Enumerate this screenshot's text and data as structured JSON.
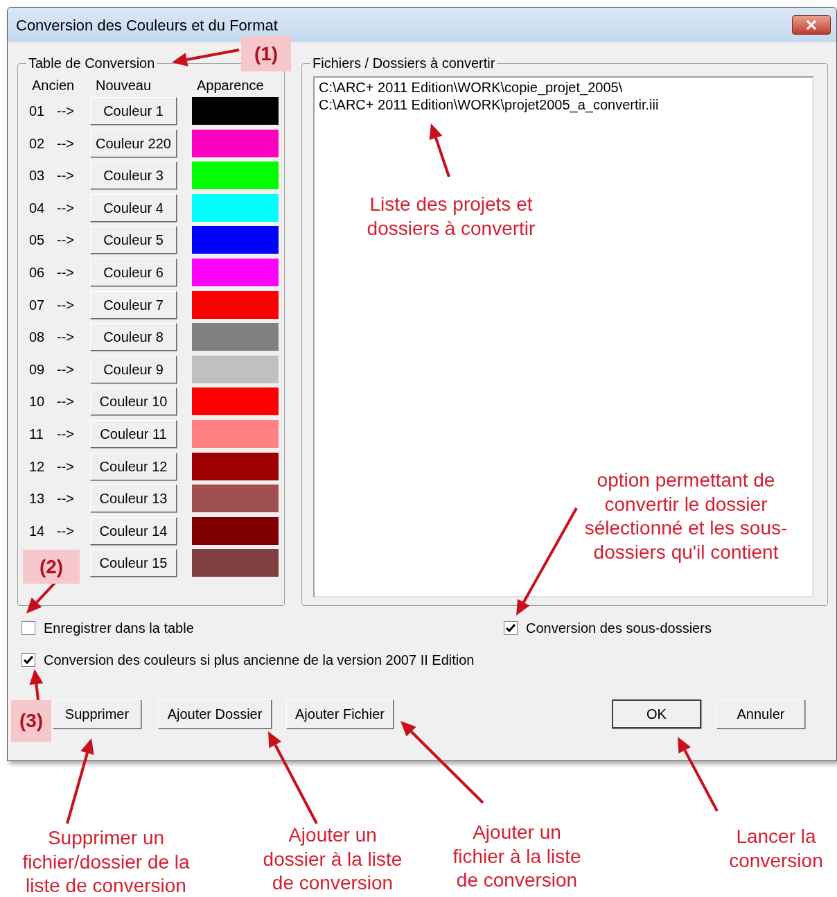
{
  "window": {
    "title": "Conversion des Couleurs et du Format"
  },
  "conversion_table": {
    "title": "Table de Conversion",
    "columns": [
      "Ancien",
      "Nouveau",
      "Apparence"
    ],
    "rows": [
      {
        "old": "01",
        "arrow": "-->",
        "button": "Couleur 1",
        "color": "#000000"
      },
      {
        "old": "02",
        "arrow": "-->",
        "button": "Couleur 220",
        "color": "#ff00c0"
      },
      {
        "old": "03",
        "arrow": "-->",
        "button": "Couleur 3",
        "color": "#00ff00"
      },
      {
        "old": "04",
        "arrow": "-->",
        "button": "Couleur 4",
        "color": "#00ffff"
      },
      {
        "old": "05",
        "arrow": "-->",
        "button": "Couleur 5",
        "color": "#0000ff"
      },
      {
        "old": "06",
        "arrow": "-->",
        "button": "Couleur 6",
        "color": "#ff00ff"
      },
      {
        "old": "07",
        "arrow": "-->",
        "button": "Couleur 7",
        "color": "#ff0000"
      },
      {
        "old": "08",
        "arrow": "-->",
        "button": "Couleur 8",
        "color": "#808080"
      },
      {
        "old": "09",
        "arrow": "-->",
        "button": "Couleur 9",
        "color": "#c0c0c0"
      },
      {
        "old": "10",
        "arrow": "-->",
        "button": "Couleur 10",
        "color": "#ff0000"
      },
      {
        "old": "11",
        "arrow": "-->",
        "button": "Couleur 11",
        "color": "#ff8080"
      },
      {
        "old": "12",
        "arrow": "-->",
        "button": "Couleur 12",
        "color": "#a00000"
      },
      {
        "old": "13",
        "arrow": "-->",
        "button": "Couleur 13",
        "color": "#a05050"
      },
      {
        "old": "14",
        "arrow": "-->",
        "button": "Couleur 14",
        "color": "#800000"
      },
      {
        "button": "Couleur 15",
        "color": "#804040"
      }
    ]
  },
  "files": {
    "title": "Fichiers / Dossiers à convertir",
    "items": [
      "C:\\ARC+ 2011 Edition\\WORK\\copie_projet_2005\\",
      "C:\\ARC+ 2011 Edition\\WORK\\projet2005_a_convertir.iii"
    ]
  },
  "checkboxes": [
    {
      "label": "Enregistrer dans la table",
      "checked": false
    },
    {
      "label": "Conversion des sous-dossiers",
      "checked": true
    },
    {
      "label": "Conversion des couleurs si plus ancienne de la version 2007 II Edition",
      "checked": true
    }
  ],
  "buttons": [
    {
      "label": "Supprimer",
      "default": false
    },
    {
      "label": "Ajouter Dossier",
      "default": false
    },
    {
      "label": "Ajouter Fichier",
      "default": false
    },
    {
      "label": "OK",
      "default": true
    },
    {
      "label": "Annuler",
      "default": false
    }
  ],
  "annotations": [
    {
      "kind": "marker",
      "text": "(1)"
    },
    {
      "kind": "marker",
      "text": "(2)"
    },
    {
      "kind": "marker",
      "text": "(3)"
    },
    {
      "kind": "note",
      "text": "Liste des projets et\ndossiers à convertir"
    },
    {
      "kind": "note",
      "text": "option permettant de\nconvertir le dossier\nsélectionné et les sous-\ndossiers qu'il contient"
    },
    {
      "kind": "note",
      "text": "Supprimer un\nfichier/dossier de la\nliste de conversion"
    },
    {
      "kind": "note",
      "text": "Ajouter un\ndossier à la liste\nde conversion"
    },
    {
      "kind": "note",
      "text": "Ajouter un\nfichier à la liste\nde conversion"
    },
    {
      "kind": "note",
      "text": "Lancer la\nconversion"
    }
  ]
}
